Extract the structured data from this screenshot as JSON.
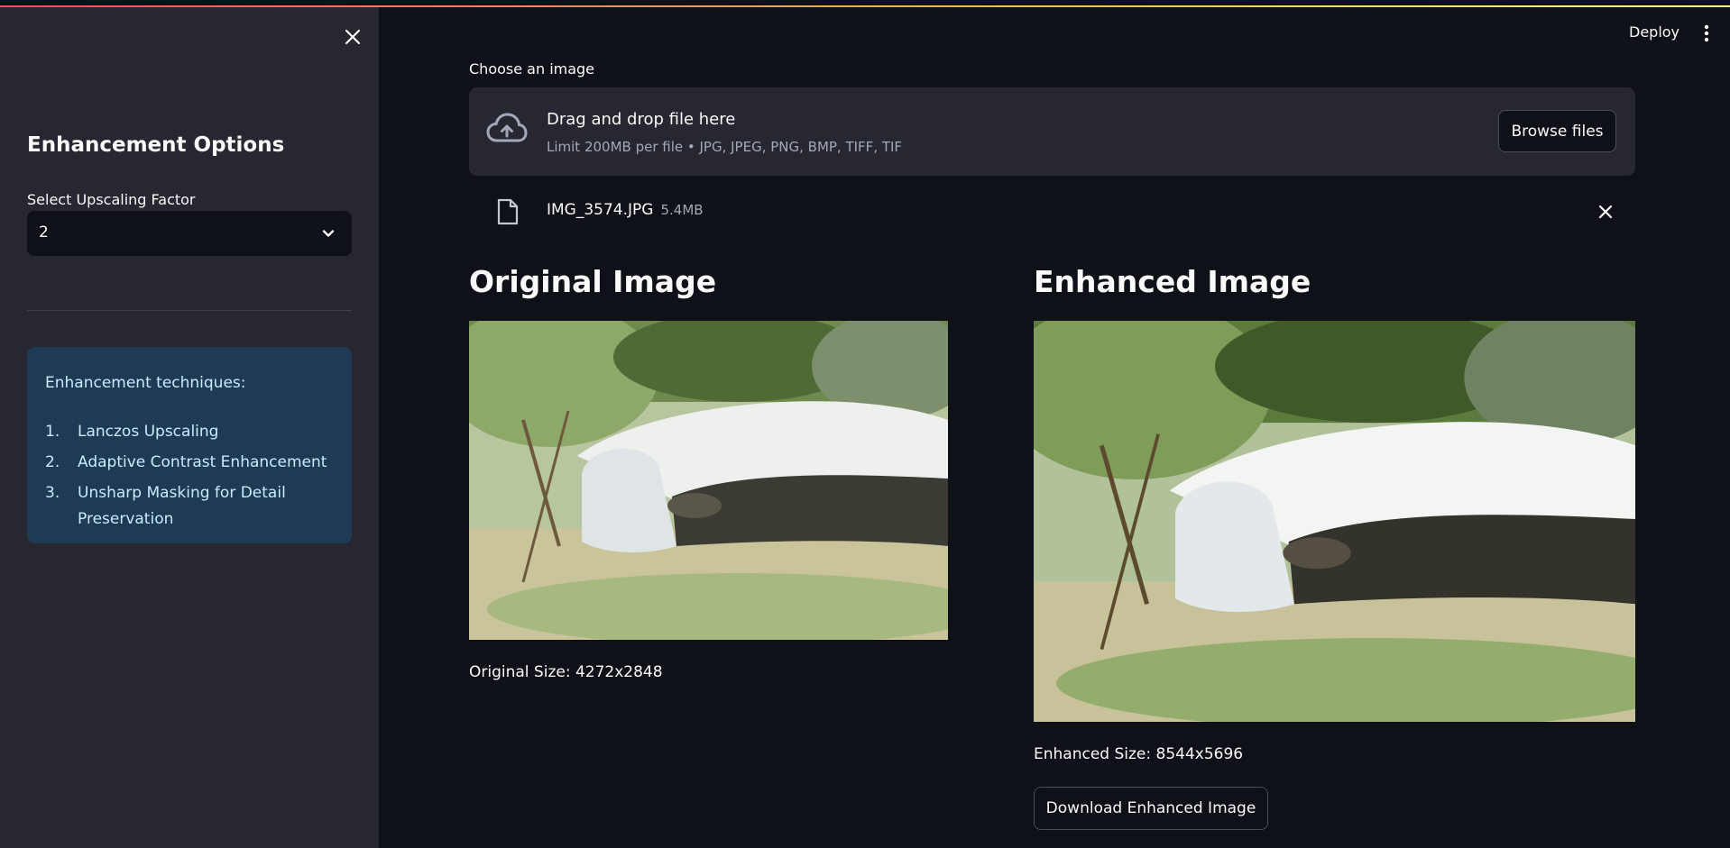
{
  "header": {
    "deploy_label": "Deploy",
    "menu_icon": "kebab-menu-icon"
  },
  "sidebar": {
    "close_icon": "close-icon",
    "title": "Enhancement Options",
    "select_label": "Select Upscaling Factor",
    "select_value": "2",
    "info": {
      "title": "Enhancement techniques:",
      "items": [
        {
          "num": "1.",
          "label": "Lanczos Upscaling"
        },
        {
          "num": "2.",
          "label": "Adaptive Contrast Enhancement"
        },
        {
          "num": "3.",
          "label": "Unsharp Masking for Detail Preservation"
        }
      ]
    }
  },
  "uploader": {
    "label": "Choose an image",
    "drag_text": "Drag and drop file here",
    "limit_text": "Limit 200MB per file • JPG, JPEG, PNG, BMP, TIFF, TIF",
    "browse_label": "Browse files",
    "file": {
      "name": "IMG_3574.JPG",
      "size": "5.4MB"
    }
  },
  "original": {
    "title": "Original Image",
    "size_text": "Original Size: 4272x2848"
  },
  "enhanced": {
    "title": "Enhanced Image",
    "size_text": "Enhanced Size: 8544x5696",
    "download_label": "Download Enhanced Image"
  },
  "colors": {
    "background": "#0e1117",
    "sidebar": "#262730",
    "info_bg": "#1f3a54",
    "info_text": "#c7ebff",
    "accent_red": "#ff4b4b"
  }
}
